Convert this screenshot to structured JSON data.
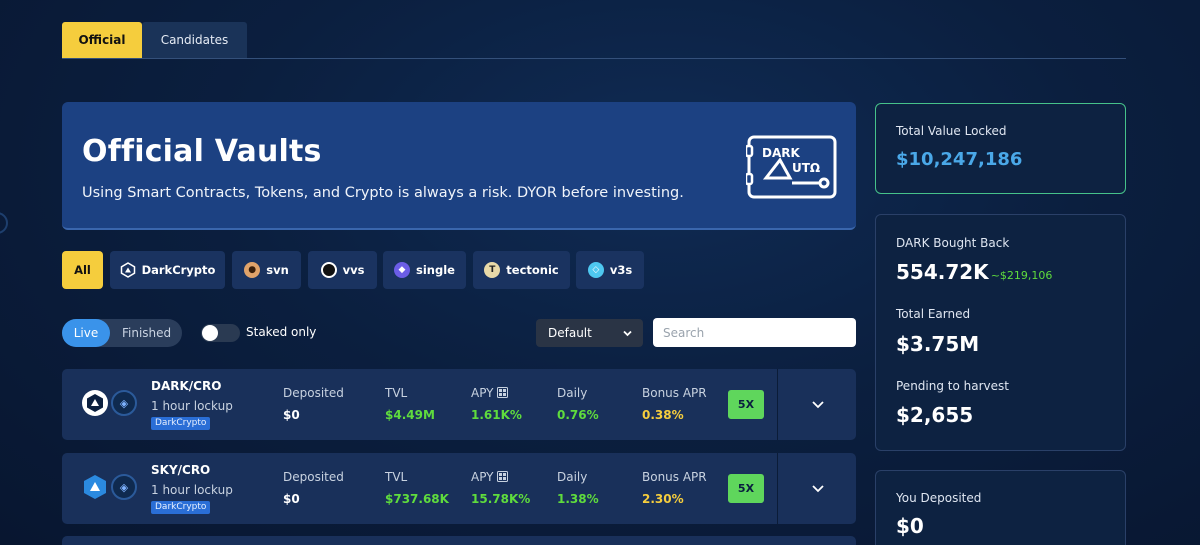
{
  "tabs": [
    {
      "label": "Official",
      "active": true
    },
    {
      "label": "Candidates",
      "active": false
    }
  ],
  "hero": {
    "title": "Official Vaults",
    "subtitle": "Using Smart Contracts, Tokens, and Crypto is always a risk. DYOR before investing.",
    "logo_line1": "DARK",
    "logo_line2": "UTΩ"
  },
  "filters": [
    {
      "label": "All",
      "active": true
    },
    {
      "label": "DarkCrypto",
      "icon": "darkcrypto-icon"
    },
    {
      "label": "svn",
      "icon": "svn-icon"
    },
    {
      "label": "vvs",
      "icon": "vvs-icon"
    },
    {
      "label": "single",
      "icon": "single-icon"
    },
    {
      "label": "tectonic",
      "icon": "tectonic-icon"
    },
    {
      "label": "v3s",
      "icon": "v3s-icon"
    }
  ],
  "controls": {
    "live_label": "Live",
    "finished_label": "Finished",
    "staked_only_label": "Staked only",
    "staked_only_on": false,
    "sort_value": "Default",
    "search_placeholder": "Search"
  },
  "vault_columns": {
    "deposited": "Deposited",
    "tvl": "TVL",
    "apy": "APY",
    "daily": "Daily",
    "bonus_apr": "Bonus APR"
  },
  "vaults": [
    {
      "pair": "DARK/CRO",
      "lockup": "1 hour lockup",
      "platform": "DarkCrypto",
      "deposited": "$0",
      "tvl": "$4.49M",
      "apy": "1.61K%",
      "daily": "0.76%",
      "bonus_apr": "0.38%",
      "boost": "5X"
    },
    {
      "pair": "SKY/CRO",
      "lockup": "1 hour lockup",
      "platform": "DarkCrypto",
      "deposited": "$0",
      "tvl": "$737.68K",
      "apy": "15.78K%",
      "daily": "1.38%",
      "bonus_apr": "2.30%",
      "boost": "5X"
    }
  ],
  "stats": {
    "tvl_label": "Total Value Locked",
    "tvl_value": "$10,247,186",
    "bought_back_label": "DARK Bought Back",
    "bought_back_value": "554.72K",
    "bought_back_usd": "~$219,106",
    "earned_label": "Total Earned",
    "earned_value": "$3.75M",
    "pending_label": "Pending to harvest",
    "pending_value": "$2,655",
    "deposited_label": "You Deposited",
    "deposited_value": "$0"
  },
  "colors": {
    "accent_yellow": "#f5cd3d",
    "positive_green": "#5fdc3d",
    "live_blue": "#3a93ea",
    "hero_blue": "#1c4182",
    "row_bg": "#19305a"
  }
}
